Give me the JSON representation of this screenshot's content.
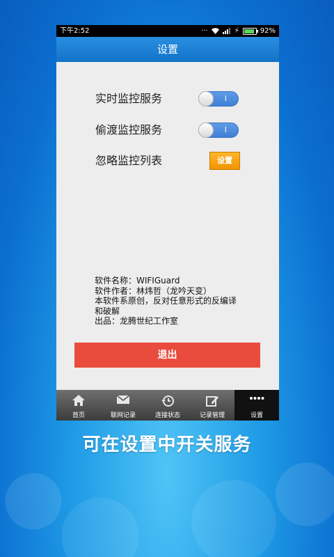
{
  "status_bar": {
    "time": "下午2:52",
    "battery": "92%",
    "battery_level": 0.92
  },
  "header": {
    "title": "设置"
  },
  "settings": {
    "realtime_label": "实时监控服务",
    "stealth_label": "偷渡监控服务",
    "ignore_label": "忽略监控列表",
    "toggle_mark": "I",
    "ignore_button": "设置"
  },
  "info": {
    "line1": "软件名称：WIFIGuard",
    "line2": "软件作者：林炜哲（龙吟天变）",
    "line3": "本软件系原创，反对任意形式的反编译和破解",
    "line4": "出品：龙腾世纪工作室"
  },
  "exit_button": "退出",
  "tabs": [
    {
      "label": "首页",
      "icon": "home-icon"
    },
    {
      "label": "联网记录",
      "icon": "mail-icon"
    },
    {
      "label": "连接状态",
      "icon": "history-icon"
    },
    {
      "label": "记录管理",
      "icon": "edit-icon"
    },
    {
      "label": "设置",
      "icon": "more-icon"
    }
  ],
  "caption": "可在设置中开关服务",
  "colors": {
    "accent": "#1a7fd6",
    "exit": "#e94c3d",
    "button": "#f5a000"
  }
}
